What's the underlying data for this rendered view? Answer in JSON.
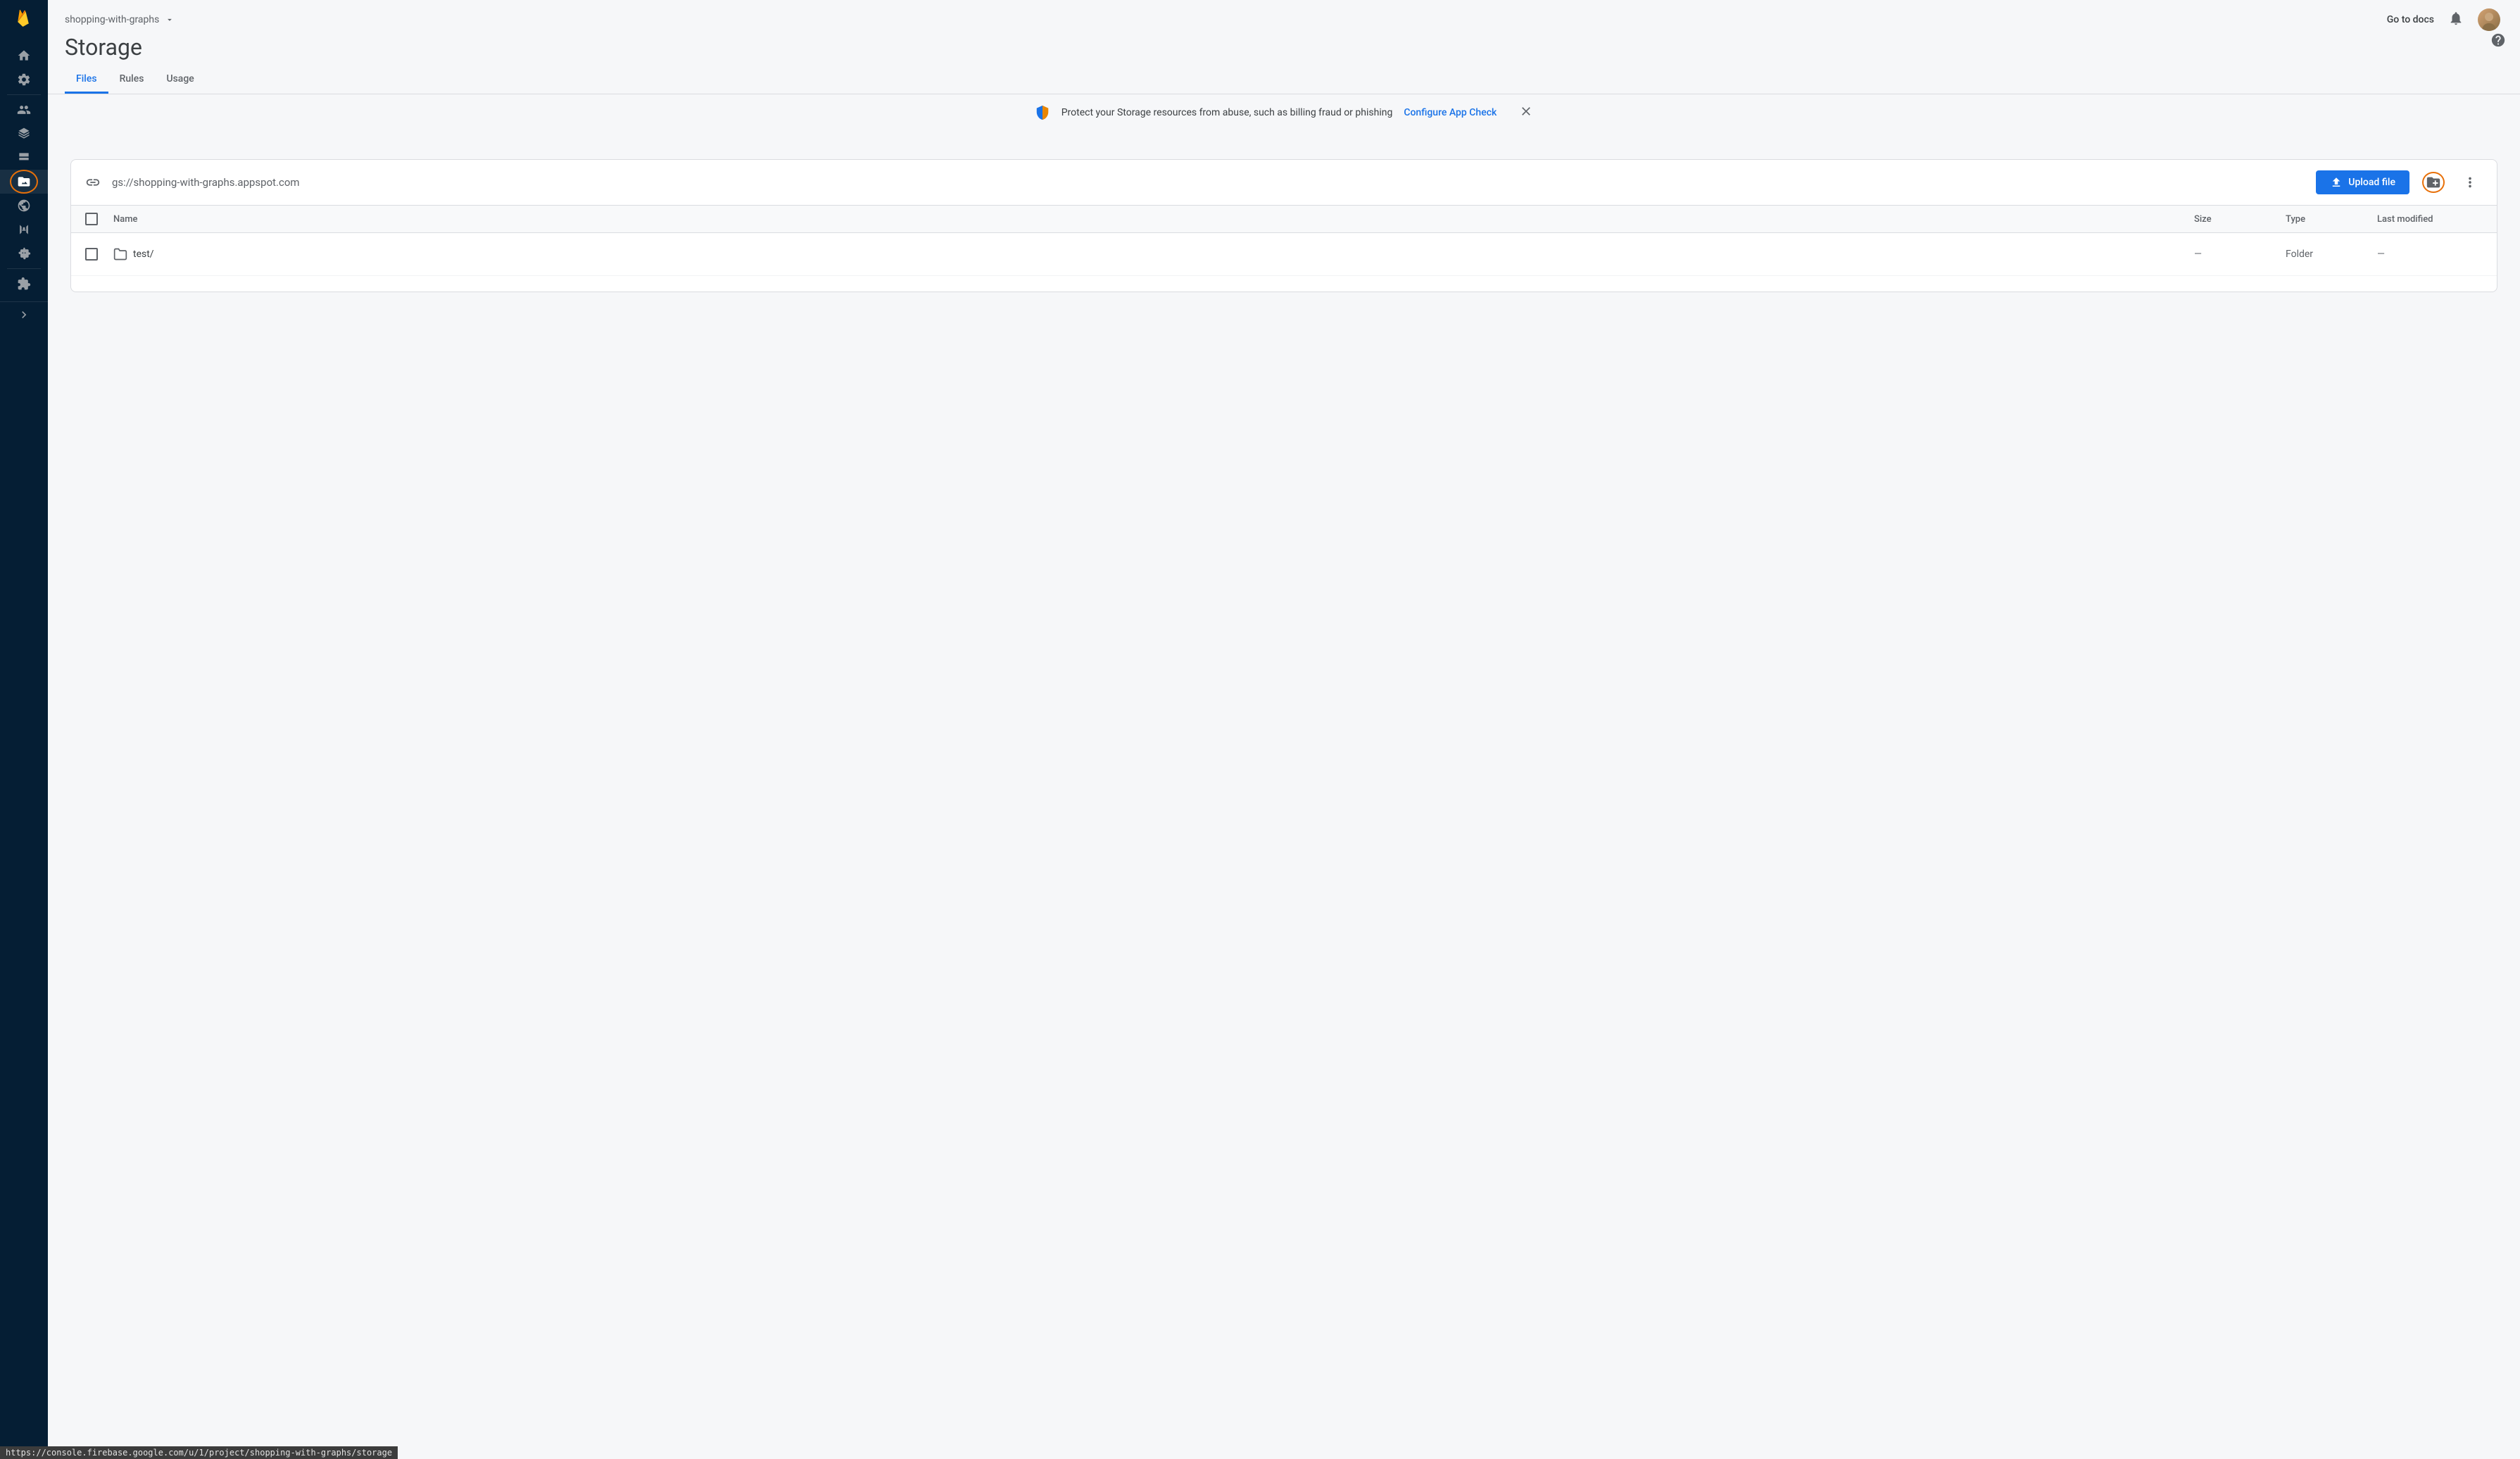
{
  "project_name": "shopping-with-graphs",
  "page_title": "Storage",
  "docs_link": "Go to docs",
  "tabs": {
    "files": "Files",
    "rules": "Rules",
    "usage": "Usage"
  },
  "banner": {
    "text": "Protect your Storage resources from abuse, such as billing fraud or phishing",
    "link": "Configure App Check"
  },
  "bucket_path": "gs://shopping-with-graphs.appspot.com",
  "upload_label": "Upload file",
  "table": {
    "headers": {
      "name": "Name",
      "size": "Size",
      "type": "Type",
      "modified": "Last modified"
    },
    "rows": [
      {
        "name": "test/",
        "size": "—",
        "type": "Folder",
        "modified": "—"
      }
    ]
  },
  "status_url": "https://console.firebase.google.com/u/1/project/shopping-with-graphs/storage"
}
